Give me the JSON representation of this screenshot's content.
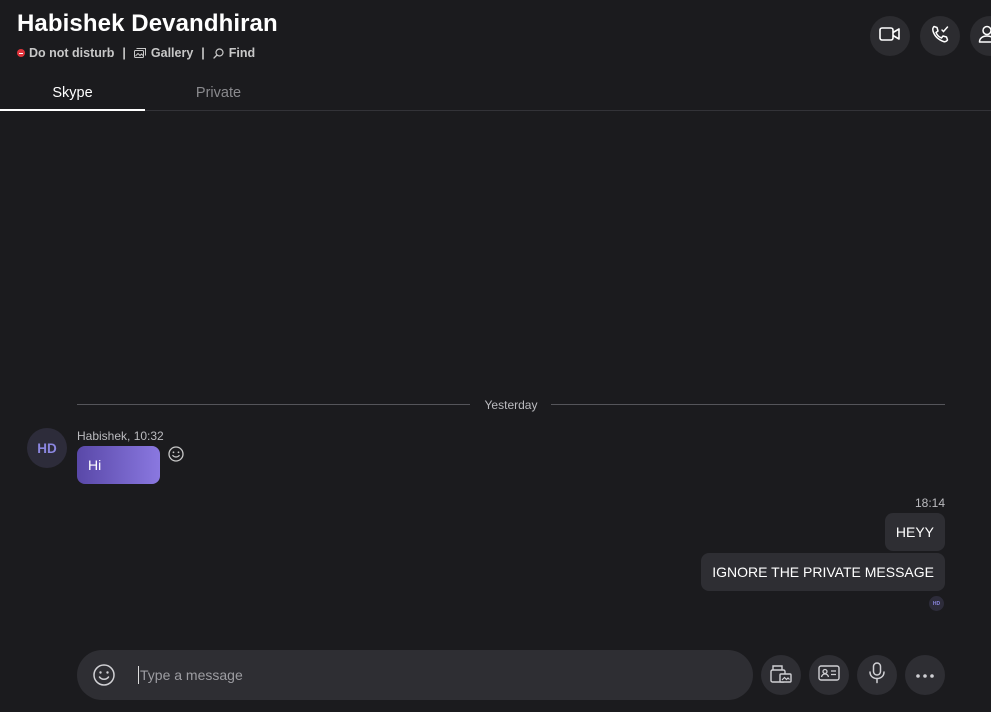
{
  "header": {
    "title": "Habishek Devandhiran",
    "status_label": "Do not disturb",
    "separator": "|",
    "gallery_label": "Gallery",
    "find_label": "Find"
  },
  "header_actions": [
    {
      "name": "video-call",
      "icon": "video-camera-icon"
    },
    {
      "name": "audio-call",
      "icon": "phone-icon"
    },
    {
      "name": "profile",
      "icon": "person-icon"
    }
  ],
  "tabs": [
    {
      "label": "Skype",
      "active": true
    },
    {
      "label": "Private",
      "active": false
    }
  ],
  "conversation": {
    "date_divider": "Yesterday",
    "incoming": {
      "avatar_initials": "HD",
      "sender_meta": "Habishek, 10:32",
      "text": "Hi"
    },
    "outgoing": {
      "time": "18:14",
      "messages": [
        "HEYY",
        "IGNORE THE PRIVATE MESSAGE"
      ],
      "read_receipt_initials": "HD"
    }
  },
  "composer": {
    "placeholder": "Type a message"
  },
  "composer_tools": [
    "media-gallery-icon",
    "contact-card-icon",
    "microphone-icon",
    "more-icon"
  ],
  "colors": {
    "background": "#1b1b1e",
    "bubble_incoming_start": "#5948a8",
    "bubble_incoming_end": "#8a78e0",
    "bubble_outgoing": "#2e2e33",
    "dnd_red": "#e0343c",
    "avatar_text": "#8b86e0"
  }
}
